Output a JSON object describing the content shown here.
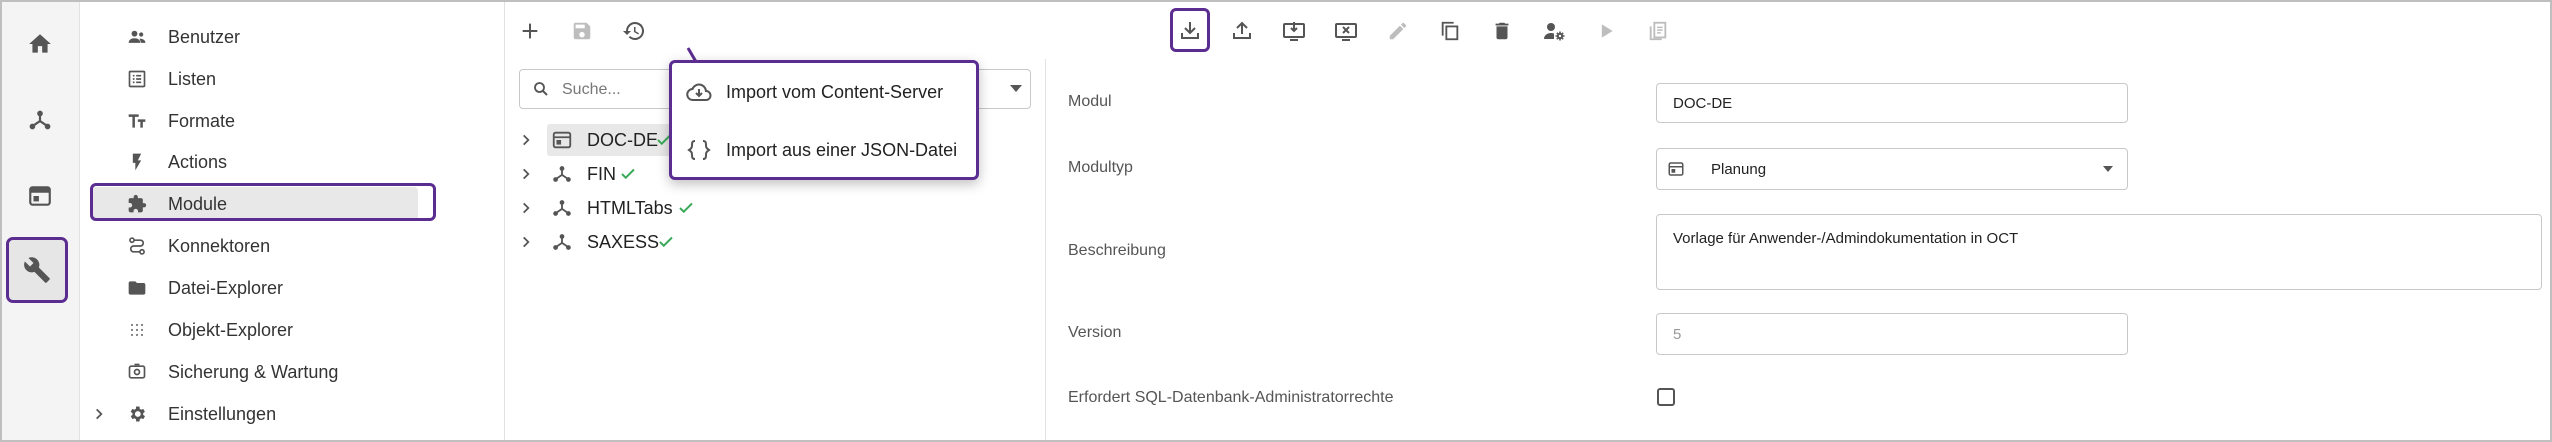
{
  "rail": {
    "items": [
      {
        "icon": "home-icon"
      },
      {
        "icon": "network-icon"
      },
      {
        "icon": "browser-window-icon"
      },
      {
        "icon": "wrench-icon"
      }
    ]
  },
  "nav": {
    "items": [
      {
        "label": "Benutzer",
        "icon": "users-icon"
      },
      {
        "label": "Listen",
        "icon": "list-icon"
      },
      {
        "label": "Formate",
        "icon": "text-format-icon"
      },
      {
        "label": "Actions",
        "icon": "lightning-icon"
      },
      {
        "label": "Module",
        "icon": "puzzle-icon"
      },
      {
        "label": "Konnektoren",
        "icon": "route-icon"
      },
      {
        "label": "Datei-Explorer",
        "icon": "folder-icon"
      },
      {
        "label": "Objekt-Explorer",
        "icon": "dots-grid-icon"
      },
      {
        "label": "Sicherung & Wartung",
        "icon": "backup-icon"
      },
      {
        "label": "Einstellungen",
        "icon": "gear-icon"
      }
    ]
  },
  "toolbar": {
    "buttons": [
      "add-icon",
      "save-icon",
      "restore-icon",
      "import-icon",
      "export-icon",
      "install-icon",
      "uninstall-icon",
      "edit-icon",
      "copy-icon",
      "delete-icon",
      "user-settings-icon",
      "run-icon",
      "report-icon"
    ]
  },
  "search": {
    "placeholder": "Suche..."
  },
  "tree": {
    "items": [
      {
        "label": "DOC-DE",
        "icon": "window-icon",
        "checked": true
      },
      {
        "label": "FIN",
        "icon": "network-icon",
        "checked": true
      },
      {
        "label": "HTMLTabs",
        "icon": "network-icon",
        "checked": true
      },
      {
        "label": "SAXESS",
        "icon": "network-icon",
        "checked": true
      }
    ]
  },
  "import_menu": {
    "items": [
      {
        "label": "Import vom Content-Server",
        "icon": "cloud-download-icon"
      },
      {
        "label": "Import aus einer JSON-Datei",
        "icon": "curly-braces-icon"
      }
    ]
  },
  "form": {
    "modul_label": "Modul",
    "modul_value": "DOC-DE",
    "modultyp_label": "Modultyp",
    "modultyp_value": "Planung",
    "beschreibung_label": "Beschreibung",
    "beschreibung_value": "Vorlage für Anwender-/Admindokumentation in OCT",
    "version_label": "Version",
    "version_value": "5",
    "sql_label": "Erfordert SQL-Datenbank-Administratorrechte",
    "sql_checked": false
  },
  "colors": {
    "accent": "#5c2d91",
    "check": "#3aaa5a"
  }
}
